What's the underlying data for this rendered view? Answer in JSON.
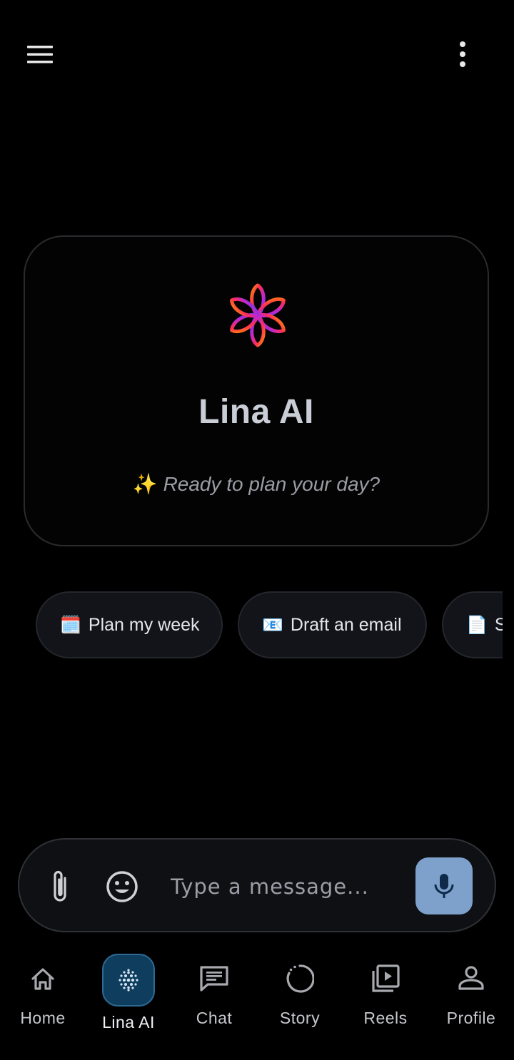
{
  "topbar": {
    "menu_icon": "hamburger-menu-icon",
    "more_icon": "more-vertical-icon"
  },
  "hero": {
    "logo_icon": "lina-ai-flower-logo",
    "title": "Lina AI",
    "subtitle_emoji": "✨",
    "subtitle": "Ready to plan your day?"
  },
  "suggestions": [
    {
      "emoji": "🗓️",
      "label": "Plan my week"
    },
    {
      "emoji": "📧",
      "label": "Draft an email"
    },
    {
      "emoji": "📄",
      "label": "S"
    }
  ],
  "composer": {
    "placeholder": "Type a message...",
    "attach_icon": "paperclip-icon",
    "emoji_icon": "smiley-icon",
    "mic_icon": "microphone-icon"
  },
  "nav": {
    "items": [
      {
        "label": "Home",
        "icon": "home-icon"
      },
      {
        "label": "Lina AI",
        "icon": "dots-sphere-icon"
      },
      {
        "label": "Chat",
        "icon": "chat-icon"
      },
      {
        "label": "Story",
        "icon": "story-ring-icon"
      },
      {
        "label": "Reels",
        "icon": "reels-icon"
      },
      {
        "label": "Profile",
        "icon": "profile-icon"
      }
    ],
    "active": "Lina AI"
  },
  "colors": {
    "background": "#000000",
    "card_border": "#2b2b2f",
    "chip_background": "#121419",
    "mic_button": "#7ea1cc",
    "nav_active_pill": "#0f3d5e"
  }
}
